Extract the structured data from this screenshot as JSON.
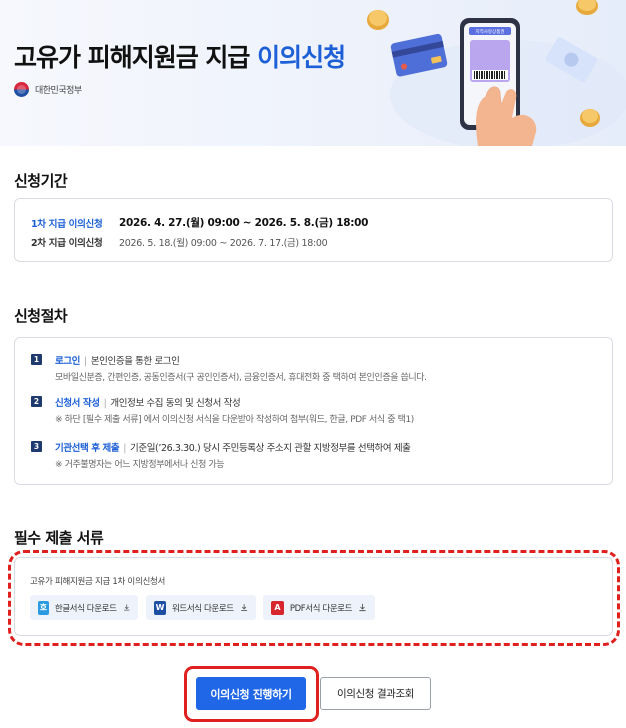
{
  "hero": {
    "title_main": "고유가 피해지원금 지급 ",
    "title_accent": "이의신청",
    "gov_label": "대한민국정부",
    "phone_screen_text": "지역사랑상품권",
    "icons": [
      "coin-icon",
      "credit-card-icon",
      "phone-icon",
      "banknote-icon"
    ]
  },
  "period": {
    "title": "신청기간",
    "rows": [
      {
        "label": "1차 지급 이의신청",
        "dates": "2026. 4. 27.(월) 09:00 ~ 2026. 5. 8.(금) 18:00"
      },
      {
        "label": "2차 지급 이의신청",
        "dates": "2026. 5. 18.(월) 09:00 ~ 2026. 7. 17.(금) 18:00"
      }
    ]
  },
  "procedure": {
    "title": "신청절차",
    "steps": [
      {
        "num": "1",
        "head": "로그인",
        "desc": "본인인증을 통한 로그인",
        "sub": "모바일신분증, 간편인증, 공동인증서(구 공인인증서), 금융인증서, 휴대전화 중 택하여 본인인증을 씁니다."
      },
      {
        "num": "2",
        "head": "신청서 작성",
        "desc": "개인정보 수집 동의 및 신청서 작성",
        "sub": "※ 하단 [필수 제출 서류] 에서 이의신청 서식을 다운받아 작성하여 첨부(워드, 한글, PDF 서식 중 택1)"
      },
      {
        "num": "3",
        "head": "기관선택 후 제출",
        "desc": "기준일(’26.3.30.) 당시 주민등록상 주소지 관할 지방정부를 선택하여 제출",
        "sub": "※ 거주불명자는 어느 지방정부에서나 신청 가능"
      }
    ]
  },
  "docs": {
    "title": "필수 제출 서류",
    "doc_name": "고유가 피해지원금 지급 1차 이의신청서",
    "downloads": [
      {
        "icon_letter": "호",
        "label": "한글서식 다운로드",
        "color": "#2a9be0"
      },
      {
        "icon_letter": "W",
        "label": "워드서식 다운로드",
        "color": "#1e4fa3"
      },
      {
        "icon_letter": "A",
        "label": "PDF서식 다운로드",
        "color": "#d7262d"
      }
    ]
  },
  "actions": {
    "primary": "이의신청 진행하기",
    "secondary": "이의신청 결과조회"
  }
}
